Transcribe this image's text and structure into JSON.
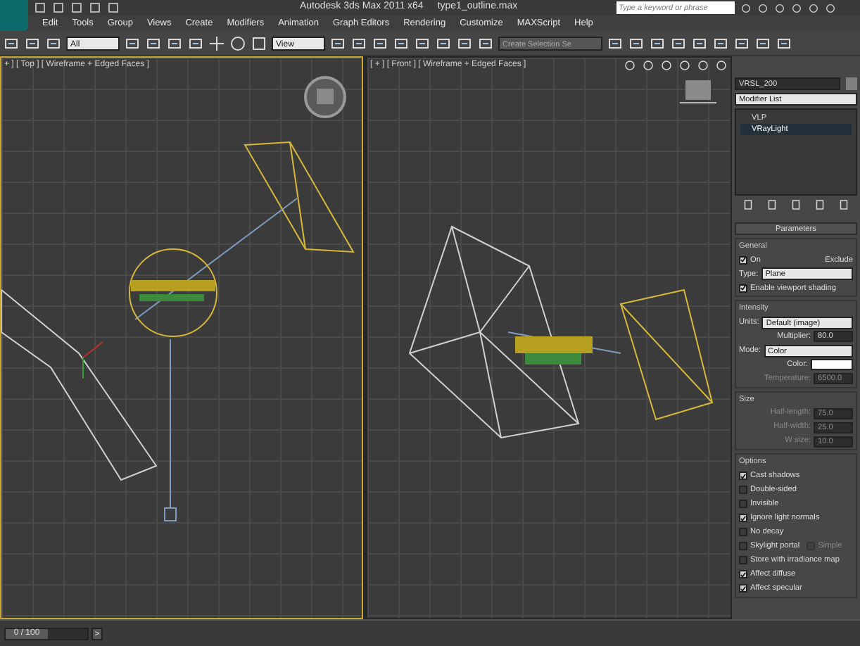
{
  "title_bar": {
    "app_title": "Autodesk 3ds Max 2011 x64",
    "file_name": "type1_outline.max",
    "search": {
      "placeholder": "Type a keyword or phrase"
    }
  },
  "menu": [
    "Edit",
    "Tools",
    "Group",
    "Views",
    "Create",
    "Modifiers",
    "Animation",
    "Graph Editors",
    "Rendering",
    "Customize",
    "MAXScript",
    "Help"
  ],
  "toolbar": {
    "selection_filter": "All",
    "reference_coordinate_system": "View",
    "selection_set": "Create Selection Se"
  },
  "viewports": [
    {
      "label": "+ ] [ Top ] [ Wireframe + Edged Faces ]",
      "active": true,
      "kind": "top"
    },
    {
      "label": "[ + ] [ Front ] [ Wireframe + Edged Faces ]",
      "active": false,
      "kind": "front"
    }
  ],
  "command_panel": {
    "object": {
      "name": "VRSL_200",
      "color": "#808080"
    },
    "modifier_list": "Modifier List",
    "stack": [
      {
        "label": "VLP",
        "selected": false
      },
      {
        "label": "VRayLight",
        "selected": true
      }
    ],
    "rollout": {
      "title": "Parameters",
      "sections": [
        {
          "title": "General",
          "rows": [
            {
              "kind": "check_button",
              "label": "On",
              "checked": true,
              "button": "Exclude"
            },
            {
              "kind": "dropdown",
              "label": "Type:",
              "value": "Plane"
            },
            {
              "kind": "checkbox",
              "label": "Enable viewport shading",
              "checked": true
            }
          ]
        },
        {
          "title": "Intensity",
          "rows": [
            {
              "kind": "dropdown",
              "label": "Units:",
              "value": "Default (image)"
            },
            {
              "kind": "spinner",
              "label": "Multiplier:",
              "value": "80.0",
              "disabled": false
            },
            {
              "kind": "dropdown",
              "label": "Mode:",
              "value": "Color"
            },
            {
              "kind": "color",
              "label": "Color:",
              "color": "#ffffff"
            },
            {
              "kind": "spinner",
              "label": "Temperature:",
              "value": "6500.0",
              "disabled": true
            }
          ]
        },
        {
          "title": "Size",
          "rows": [
            {
              "kind": "spinner",
              "label": "Half-length:",
              "value": "75.0",
              "disabled": true
            },
            {
              "kind": "spinner",
              "label": "Half-width:",
              "value": "25.0",
              "disabled": true
            },
            {
              "kind": "spinner",
              "label": "W size:",
              "value": "10.0",
              "disabled": true
            }
          ]
        },
        {
          "title": "Options",
          "rows": [
            {
              "kind": "checkbox",
              "label": "Cast shadows",
              "checked": true
            },
            {
              "kind": "checkbox",
              "label": "Double-sided",
              "checked": false
            },
            {
              "kind": "checkbox",
              "label": "Invisible",
              "checked": false
            },
            {
              "kind": "checkbox",
              "label": "Ignore light normals",
              "checked": true
            },
            {
              "kind": "checkbox",
              "label": "No decay",
              "checked": false
            },
            {
              "kind": "checkbox",
              "label": "Skylight portal",
              "checked": false,
              "extra": {
                "label": "Simple",
                "checked": false
              }
            },
            {
              "kind": "checkbox",
              "label": "Store with irradiance map",
              "checked": false
            },
            {
              "kind": "checkbox",
              "label": "Affect diffuse",
              "checked": true
            },
            {
              "kind": "checkbox",
              "label": "Affect specular",
              "checked": true
            }
          ]
        }
      ]
    }
  },
  "time_slider": {
    "frame": "0 / 100",
    "level": 0,
    "next": ">"
  }
}
